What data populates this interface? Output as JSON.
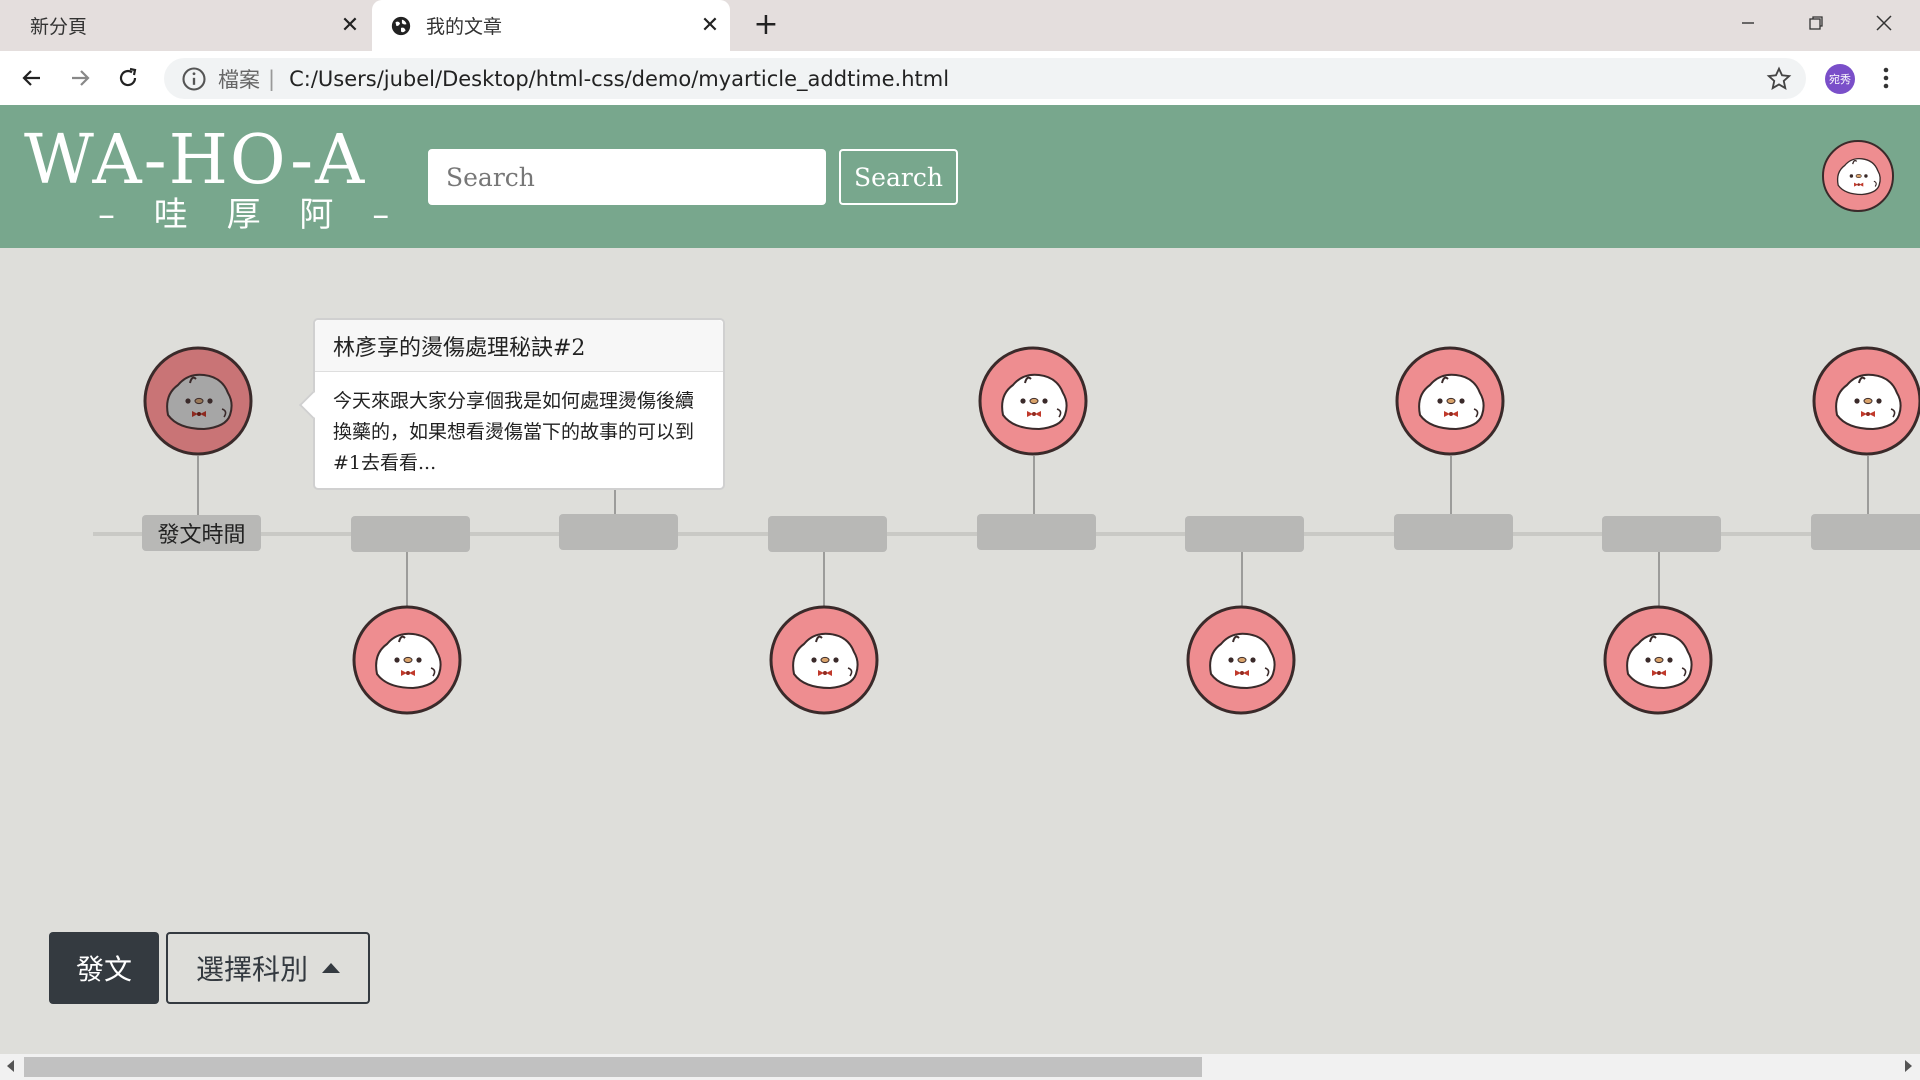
{
  "browser": {
    "tabs": [
      {
        "title": "新分頁",
        "active": false
      },
      {
        "title": "我的文章",
        "active": true
      }
    ],
    "address": {
      "scheme_label": "檔案",
      "url": "C:/Users/jubel/Desktop/html-css/demo/myarticle_addtime.html"
    },
    "profile_label": "宛秀"
  },
  "header": {
    "logo_main": "WA-HO-A",
    "logo_sub": "– 哇 厚 阿 –",
    "search_placeholder": "Search",
    "search_button": "Search",
    "colors": {
      "bar": "#78a78d",
      "accent": "#ffffff"
    }
  },
  "timeline": {
    "first_label": "發文時間",
    "node_count": 9,
    "popover": {
      "title": "林彥享的燙傷處理秘訣#2",
      "body": "今天來跟大家分享個我是如何處理燙傷後續換藥的，如果想看燙傷當下的故事的可以到#1去看看..."
    },
    "avatar_colors": {
      "ring": "#ee8d90",
      "ring_active": "#c97476",
      "outline": "#3a2a2a"
    }
  },
  "controls": {
    "post_button": "發文",
    "subject_button": "選擇科別"
  }
}
